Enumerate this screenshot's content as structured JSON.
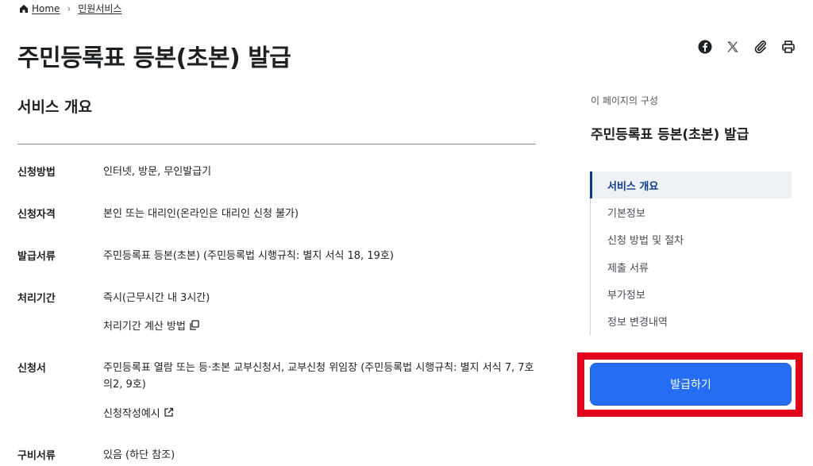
{
  "breadcrumb": {
    "home": "Home",
    "current": "민원서비스"
  },
  "page_title": "주민등록표 등본(초본) 발급",
  "share_tools": [
    "facebook-icon",
    "x-icon",
    "link-icon",
    "print-icon"
  ],
  "section_title": "서비스 개요",
  "rows": {
    "method": {
      "label": "신청방법",
      "value": "인터넷, 방문, 무인발급기"
    },
    "eligibility": {
      "label": "신청자격",
      "value": "본인 또는 대리인(온라인은 대리인 신청 불가)"
    },
    "documents": {
      "label": "발급서류",
      "value": "주민등록표 등본(초본) (주민등록법 시행규칙: 별지 서식 18, 19호)"
    },
    "period": {
      "label": "처리기간",
      "value": "즉시(근무시간 내 3시간)",
      "link": "처리기간 계산 방법"
    },
    "form": {
      "label": "신청서",
      "value": "주민등록표 열람 또는 등·초본 교부신청서, 교부신청 위임장 (주민등록법 시행규칙: 별지 서식 7, 7호의2, 9호)",
      "link": "신청작성예시"
    },
    "required": {
      "label": "구비서류",
      "value": "있음 (하단 참조)"
    }
  },
  "toc": {
    "caption": "이 페이지의 구성",
    "title": "주민등록표 등본(초본) 발급",
    "items": [
      "서비스 개요",
      "기본정보",
      "신청 방법 및 절차",
      "제출 서류",
      "부가정보",
      "정보 변경내역"
    ]
  },
  "issue_button_label": "발급하기",
  "colors": {
    "primary": "#256ef4",
    "highlight": "#e3001b",
    "toc_active": "#0b3b8c"
  }
}
